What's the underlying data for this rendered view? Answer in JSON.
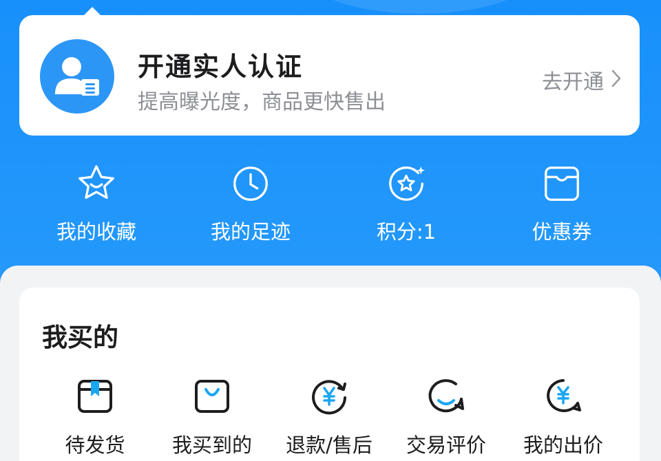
{
  "verify_card": {
    "title": "开通实人认证",
    "subtitle": "提高曝光度，商品更快售出",
    "action": "去开通",
    "icon": "user-id-icon"
  },
  "quick_links": [
    {
      "label": "我的收藏",
      "icon": "star-icon"
    },
    {
      "label": "我的足迹",
      "icon": "clock-icon"
    },
    {
      "label": "积分:1",
      "icon": "points-icon"
    },
    {
      "label": "优惠券",
      "icon": "coupon-icon"
    }
  ],
  "bought": {
    "title": "我买的",
    "items": [
      {
        "label": "待发货",
        "icon": "package-icon"
      },
      {
        "label": "我买到的",
        "icon": "shopping-bag-icon"
      },
      {
        "label": "退款/售后",
        "icon": "refund-icon"
      },
      {
        "label": "交易评价",
        "icon": "review-icon"
      },
      {
        "label": "我的出价",
        "icon": "bid-icon"
      }
    ]
  },
  "colors": {
    "header_blue": "#1890fb",
    "accent_cyan": "#1aa7f2",
    "card_bg": "#ffffff",
    "page_bg": "#f2f3f5",
    "text_dark": "#1d1d1f",
    "text_muted": "#8d8f94"
  }
}
